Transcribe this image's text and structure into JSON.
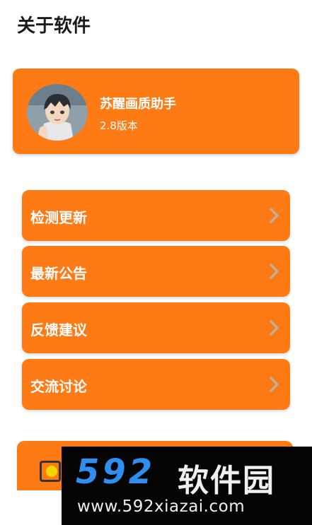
{
  "header": {
    "title": "关于软件"
  },
  "app": {
    "name": "苏醒画质助手",
    "version": "2.8版本"
  },
  "menu": {
    "items": [
      {
        "label": "检测更新"
      },
      {
        "label": "最新公告"
      },
      {
        "label": "反馈建议"
      },
      {
        "label": "交流讨论"
      }
    ]
  },
  "watermark": {
    "brand_number": "592",
    "brand_text": "软件园",
    "url": "www.592xiazai.com"
  },
  "colors": {
    "accent": "#fd7a14",
    "text_on_accent": "#ffffff",
    "watermark_blue": "#2f8ff0"
  },
  "icons": {
    "avatar": "anime-character-avatar",
    "chevron": "chevron-right-icon"
  }
}
